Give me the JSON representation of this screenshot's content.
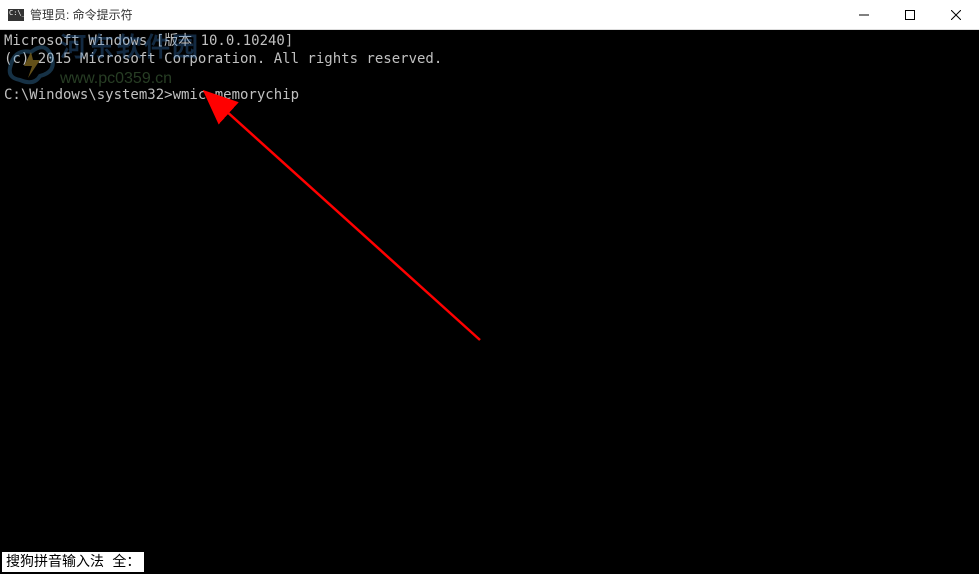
{
  "window": {
    "title": "管理员: 命令提示符",
    "controls": {
      "minimize": "minimize",
      "maximize": "maximize",
      "close": "close"
    }
  },
  "terminal": {
    "line1": "Microsoft Windows [版本 10.0.10240]",
    "line2": "(c) 2015 Microsoft Corporation. All rights reserved.",
    "prompt": "C:\\Windows\\system32>",
    "command": "wmic memorychip"
  },
  "watermark": {
    "cn": "河东软件园",
    "url": "www.pc0359.cn"
  },
  "ime": {
    "text": "搜狗拼音输入法 全："
  },
  "colors": {
    "arrow": "#ff0000",
    "term_fg": "#c0c0c0",
    "term_bg": "#000000"
  }
}
